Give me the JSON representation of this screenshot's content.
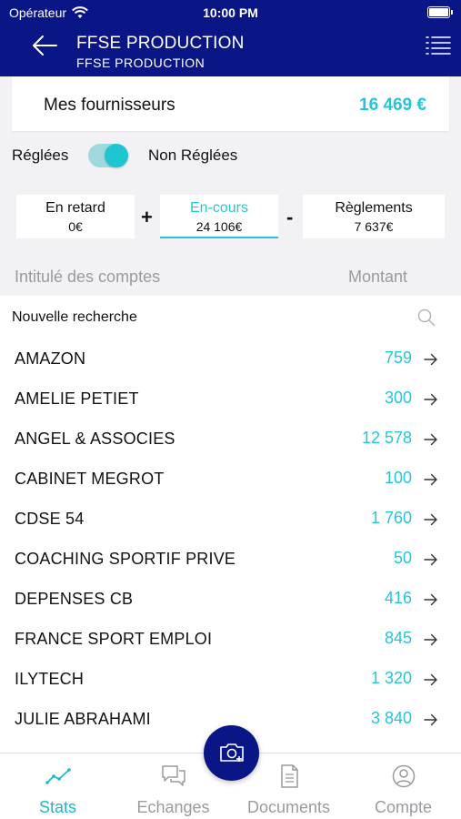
{
  "status_bar": {
    "carrier": "Opérateur",
    "time": "10:00 PM"
  },
  "nav": {
    "title": "FFSE PRODUCTION",
    "subtitle": "FFSE PRODUCTION"
  },
  "summary": {
    "label": "Mes fournisseurs",
    "total": "16 469 €"
  },
  "filter": {
    "left_label": "Réglées",
    "right_label": "Non Réglées",
    "state": "non_reglees"
  },
  "tabs": [
    {
      "label": "En retard",
      "value": "0€",
      "active": false
    },
    {
      "label": "En-cours",
      "value": "24 106€",
      "active": true
    },
    {
      "label": "Règlements",
      "value": "7 637€",
      "active": false
    }
  ],
  "operators": {
    "plus": "+",
    "minus": "-"
  },
  "columns": {
    "name": "Intitulé des comptes",
    "amount": "Montant"
  },
  "search": {
    "placeholder": "Nouvelle recherche",
    "value": ""
  },
  "accounts": [
    {
      "name": "AMAZON",
      "amount": "759"
    },
    {
      "name": "AMELIE PETIET",
      "amount": "300"
    },
    {
      "name": "ANGEL & ASSOCIES",
      "amount": "12 578"
    },
    {
      "name": "CABINET MEGROT",
      "amount": "100"
    },
    {
      "name": "CDSE 54",
      "amount": "1 760"
    },
    {
      "name": "COACHING SPORTIF PRIVE",
      "amount": "50"
    },
    {
      "name": "DEPENSES CB",
      "amount": "416"
    },
    {
      "name": "FRANCE SPORT EMPLOI",
      "amount": "845"
    },
    {
      "name": "ILYTECH",
      "amount": "1 320"
    },
    {
      "name": "JULIE ABRAHAMI",
      "amount": "3 840"
    }
  ],
  "tab_bar": [
    {
      "label": "Stats",
      "icon": "stats-icon",
      "active": true
    },
    {
      "label": "Echanges",
      "icon": "chat-icon",
      "active": false
    },
    {
      "label": "Documents",
      "icon": "document-icon",
      "active": false
    },
    {
      "label": "Compte",
      "icon": "account-icon",
      "active": false
    }
  ],
  "colors": {
    "primary": "#0b1686",
    "accent": "#23c6d8",
    "muted": "#9a9a9f"
  }
}
